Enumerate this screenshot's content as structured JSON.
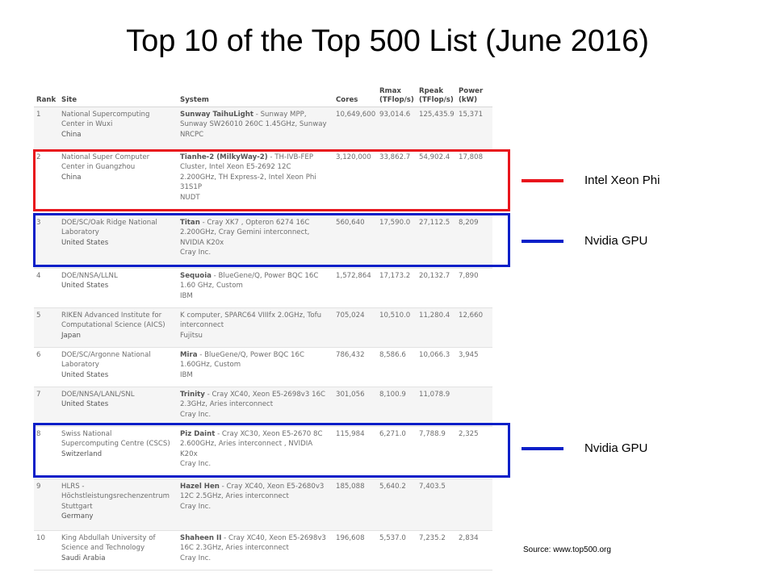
{
  "title": "Top 10 of the Top 500 List (June 2016)",
  "table": {
    "headers": {
      "rank": "Rank",
      "site": "Site",
      "system": "System",
      "cores": "Cores",
      "rmax_1": "Rmax",
      "rmax_2": "(TFlop/s)",
      "rpeak_1": "Rpeak",
      "rpeak_2": "(TFlop/s)",
      "power_1": "Power",
      "power_2": "(kW)"
    },
    "rows": [
      {
        "rank": "1",
        "site": [
          "National Supercomputing",
          "Center in Wuxi"
        ],
        "country": "China",
        "system_name": "Sunway TaihuLight",
        "system_lines": [
          " - Sunway MPP,",
          "Sunway SW26010 260C 1.45GHz, Sunway",
          "NRCPC"
        ],
        "cores": "10,649,600",
        "rmax": "93,014.6",
        "rpeak": "125,435.9",
        "power": "15,371"
      },
      {
        "rank": "2",
        "site": [
          "National Super Computer",
          "Center in Guangzhou"
        ],
        "country": "China",
        "system_name": "Tianhe-2 (MilkyWay-2)",
        "system_lines": [
          " - TH-IVB-FEP",
          "Cluster, Intel Xeon E5-2692 12C",
          "2.200GHz, TH Express-2, Intel Xeon Phi",
          "31S1P",
          "NUDT"
        ],
        "cores": "3,120,000",
        "rmax": "33,862.7",
        "rpeak": "54,902.4",
        "power": "17,808"
      },
      {
        "rank": "3",
        "site": [
          "DOE/SC/Oak Ridge National",
          "Laboratory"
        ],
        "country": "United States",
        "system_name": "Titan",
        "system_lines": [
          " - Cray XK7 , Opteron 6274 16C",
          "2.200GHz, Cray Gemini interconnect,",
          "NVIDIA K20x",
          "Cray Inc."
        ],
        "cores": "560,640",
        "rmax": "17,590.0",
        "rpeak": "27,112.5",
        "power": "8,209"
      },
      {
        "rank": "4",
        "site": [
          "DOE/NNSA/LLNL"
        ],
        "country": "United States",
        "system_name": "Sequoia",
        "system_lines": [
          " - BlueGene/Q, Power BQC 16C",
          "1.60 GHz, Custom",
          "IBM"
        ],
        "cores": "1,572,864",
        "rmax": "17,173.2",
        "rpeak": "20,132.7",
        "power": "7,890"
      },
      {
        "rank": "5",
        "site": [
          "RIKEN Advanced Institute for",
          "Computational Science (AICS)"
        ],
        "country": "Japan",
        "system_name": "",
        "system_lines": [
          "K computer, SPARC64 VIIIfx 2.0GHz, Tofu",
          "interconnect",
          "Fujitsu"
        ],
        "cores": "705,024",
        "rmax": "10,510.0",
        "rpeak": "11,280.4",
        "power": "12,660"
      },
      {
        "rank": "6",
        "site": [
          "DOE/SC/Argonne National",
          "Laboratory"
        ],
        "country": "United States",
        "system_name": "Mira",
        "system_lines": [
          " - BlueGene/Q, Power BQC 16C",
          "1.60GHz, Custom",
          "IBM"
        ],
        "cores": "786,432",
        "rmax": "8,586.6",
        "rpeak": "10,066.3",
        "power": "3,945"
      },
      {
        "rank": "7",
        "site": [
          "DOE/NNSA/LANL/SNL"
        ],
        "country": "United States",
        "system_name": "Trinity",
        "system_lines": [
          " - Cray XC40, Xeon E5-2698v3 16C",
          "2.3GHz, Aries interconnect",
          "Cray Inc."
        ],
        "cores": "301,056",
        "rmax": "8,100.9",
        "rpeak": "11,078.9",
        "power": ""
      },
      {
        "rank": "8",
        "site": [
          "Swiss National",
          "Supercomputing Centre (CSCS)"
        ],
        "country": "Switzerland",
        "system_name": "Piz Daint",
        "system_lines": [
          " - Cray XC30, Xeon E5-2670 8C",
          "2.600GHz, Aries interconnect , NVIDIA",
          "K20x",
          "Cray Inc."
        ],
        "cores": "115,984",
        "rmax": "6,271.0",
        "rpeak": "7,788.9",
        "power": "2,325"
      },
      {
        "rank": "9",
        "site": [
          "HLRS -",
          "Höchstleistungsrechenzentrum",
          "Stuttgart"
        ],
        "country": "Germany",
        "system_name": "Hazel Hen",
        "system_lines": [
          " - Cray XC40, Xeon E5-2680v3",
          "12C 2.5GHz, Aries interconnect",
          "Cray Inc."
        ],
        "cores": "185,088",
        "rmax": "5,640.2",
        "rpeak": "7,403.5",
        "power": ""
      },
      {
        "rank": "10",
        "site": [
          "King Abdullah University of",
          "Science and Technology"
        ],
        "country": "Saudi Arabia",
        "system_name": "Shaheen II",
        "system_lines": [
          " - Cray XC40, Xeon E5-2698v3",
          "16C 2.3GHz, Aries interconnect",
          "Cray Inc."
        ],
        "cores": "196,608",
        "rmax": "5,537.0",
        "rpeak": "7,235.2",
        "power": "2,834"
      }
    ]
  },
  "annotations": [
    {
      "label": "Intel Xeon Phi",
      "color": "#e8141c"
    },
    {
      "label": "Nvidia GPU",
      "color": "#0a1fc8"
    },
    {
      "label": "Nvidia GPU",
      "color": "#0a1fc8"
    }
  ],
  "source": "Source: www.top500.org"
}
